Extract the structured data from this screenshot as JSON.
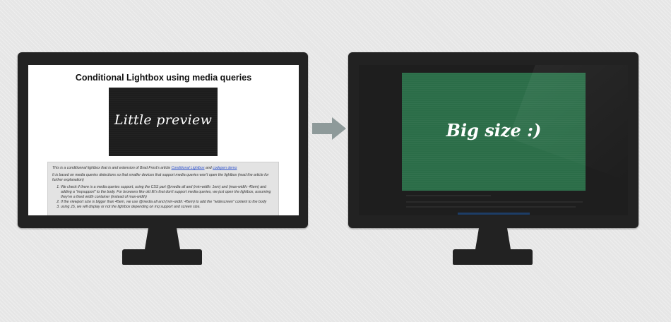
{
  "left_monitor": {
    "page_title": "Conditional Lightbox using media queries",
    "preview_text": "Little preview",
    "intro_prefix": "This is a conditionnal lightbox that is and extension of Brad Frost's article ",
    "link_lightbox": "Conditional Lightbox",
    "intro_and": " and ",
    "link_codepen": "codepen demo",
    "paragraph2": "It is based on media queries detections so that smaller devices that support media queries won't open the lightbox (read the article for further explanation)",
    "steps": [
      "We check if there is a media queries support, using the CSS part @media all and (min-width: 1em) and (max-width: 45em) and adding a \"mqsupport\" to the body. For browsers like old IE's that don't support media queries, we just open the lightbox, assuming they've a fixed width container (instead of max-width)",
      "If the viewport size is bigger than 45em, we use @media all and (min-width: 45em) to add the \"widescreen\" content to the body",
      "using JS, we will display or not the lightbox depending on mq support and screen size."
    ]
  },
  "right_monitor": {
    "big_text": "Big size :)"
  },
  "colors": {
    "bezel": "#222222",
    "arrow": "#8e9a9a",
    "big_box": "#2b6d48",
    "preview_box": "#1d1d1d"
  }
}
